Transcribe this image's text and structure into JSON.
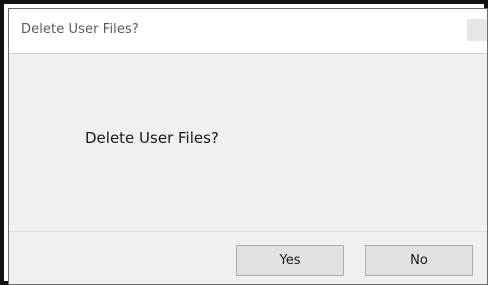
{
  "window": {
    "title": "Delete User Files?",
    "close_icon": "close-icon"
  },
  "message": {
    "text": "Delete User Files?"
  },
  "buttons": {
    "yes_label": "Yes",
    "no_label": "No"
  },
  "colors": {
    "dialog_background": "#f0f0f0",
    "titlebar_background": "#ffffff",
    "button_background": "#e1e1e1",
    "frame_border": "#111111"
  }
}
